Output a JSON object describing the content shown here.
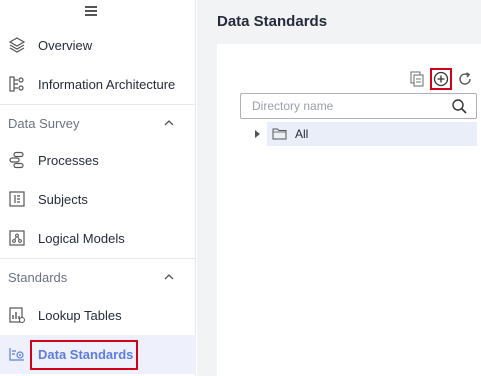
{
  "sidebar": {
    "items": [
      {
        "label": "Overview",
        "icon": "layers-icon"
      },
      {
        "label": "Information Architecture",
        "icon": "architecture-icon"
      }
    ],
    "sections": [
      {
        "label": "Data Survey",
        "items": [
          {
            "label": "Processes",
            "icon": "processes-icon"
          },
          {
            "label": "Subjects",
            "icon": "subjects-icon"
          },
          {
            "label": "Logical Models",
            "icon": "logical-models-icon"
          }
        ]
      },
      {
        "label": "Standards",
        "items": [
          {
            "label": "Lookup Tables",
            "icon": "lookup-tables-icon"
          },
          {
            "label": "Data Standards",
            "icon": "data-standards-icon",
            "active": true
          }
        ]
      }
    ]
  },
  "main": {
    "title": "Data Standards",
    "toolbar": {
      "icons": [
        "import-icon",
        "add-circle-icon",
        "refresh-icon"
      ]
    },
    "search": {
      "placeholder": "Directory name",
      "value": ""
    },
    "tree": [
      {
        "label": "All",
        "expanded": false
      }
    ]
  },
  "colors": {
    "accent": "#5e7ce0",
    "highlight": "#d0021b",
    "header_bg": "#f2f3f5",
    "active_bg": "#eef1fb"
  }
}
